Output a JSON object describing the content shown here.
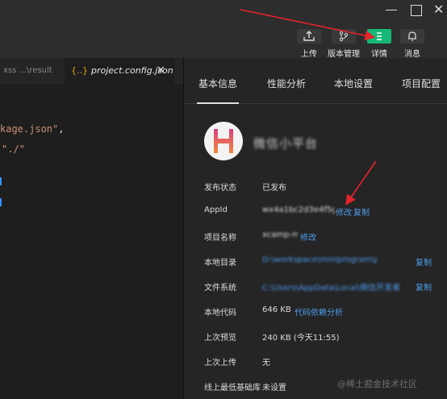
{
  "toolbar": {
    "upload_label": "上传",
    "version_label": "版本管理",
    "details_label": "详情",
    "messages_label": "消息"
  },
  "editor_tabs": {
    "tab1_label": "xss ...\\result",
    "tab2_icon": "{..}",
    "tab2_label": "project.config.json",
    "tab2_close": "✕"
  },
  "code": {
    "line1": "kage.json\"",
    "line1_punct": ",",
    "line2": "\"./\""
  },
  "panel_tabs": [
    "基本信息",
    "性能分析",
    "本地设置",
    "项目配置"
  ],
  "app": {
    "name": "微信小平台"
  },
  "info": {
    "publish_status_label": "发布状态",
    "publish_status_value": "已发布",
    "appid_label": "AppId",
    "appid_value": "wx4a1bc2d3e4f5g6h7",
    "appid_modify": "修改",
    "appid_copy": "复制",
    "project_name_label": "项目名称",
    "project_name_value": "xcamp-mini",
    "project_name_modify": "修改",
    "local_dir_label": "本地目录",
    "local_dir_value": "D:\\workspace\\miniprogram\\project",
    "local_dir_copy": "复制",
    "filesystem_label": "文件系统",
    "filesystem_value": "C:\\Users\\AppData\\Local\\微信开发者",
    "filesystem_copy": "复制",
    "local_code_label": "本地代码",
    "local_code_value": "646 KB",
    "local_code_link": "代码依赖分析",
    "last_preview_label": "上次预览",
    "last_preview_value": "240 KB (今天11:55)",
    "last_upload_label": "上次上传",
    "last_upload_value": "无",
    "min_lib_label": "线上最低基础库",
    "min_lib_value": "未设置"
  },
  "watermark": "@稀土掘金技术社区",
  "colors": {
    "accent_green": "#16b776",
    "link_blue": "#4c9be8",
    "annotation_red": "#e5232a"
  }
}
